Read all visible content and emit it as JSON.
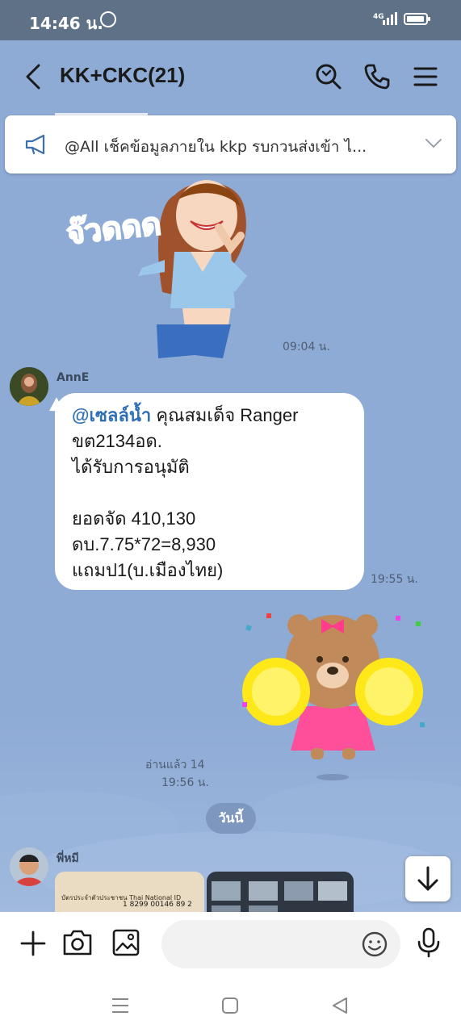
{
  "status": {
    "time": "14:46 น.",
    "network": "4G"
  },
  "header": {
    "title": "KK+CKC(21)"
  },
  "announcement": {
    "text": "@All  เช็คข้อมูลภายใน kkp รบกวนส่งเข้า ไ..."
  },
  "sticker1": {
    "caption": "จ๊วดดด",
    "time": "09:04 น."
  },
  "message": {
    "sender": "AnnE",
    "mention": "@เซลล์น้ำ",
    "line1_rest": " คุณสมเด็จ Ranger",
    "line2": "ขต2134อด.",
    "line3": "ได้รับการอนุมัติ",
    "line4": "ยอดจัด 410,130",
    "line5": "ดบ.7.75*72=8,930",
    "line6": "แถมป1(บ.เมืองไทย)",
    "time": "19:55 น."
  },
  "sticker2": {
    "read": "อ่านแล้ว 14",
    "time": "19:56 น."
  },
  "date_divider": "วันนี้",
  "next_sender": "พี่หมี",
  "id_card": {
    "line1": "บัตรประจำตัวประชาชน Thai National ID",
    "line2": "1 8299 00146 89 2"
  },
  "colors": {
    "chat_bg": "#8eabd6",
    "status_bg": "#5e7186",
    "mention": "#2e6fb5"
  }
}
